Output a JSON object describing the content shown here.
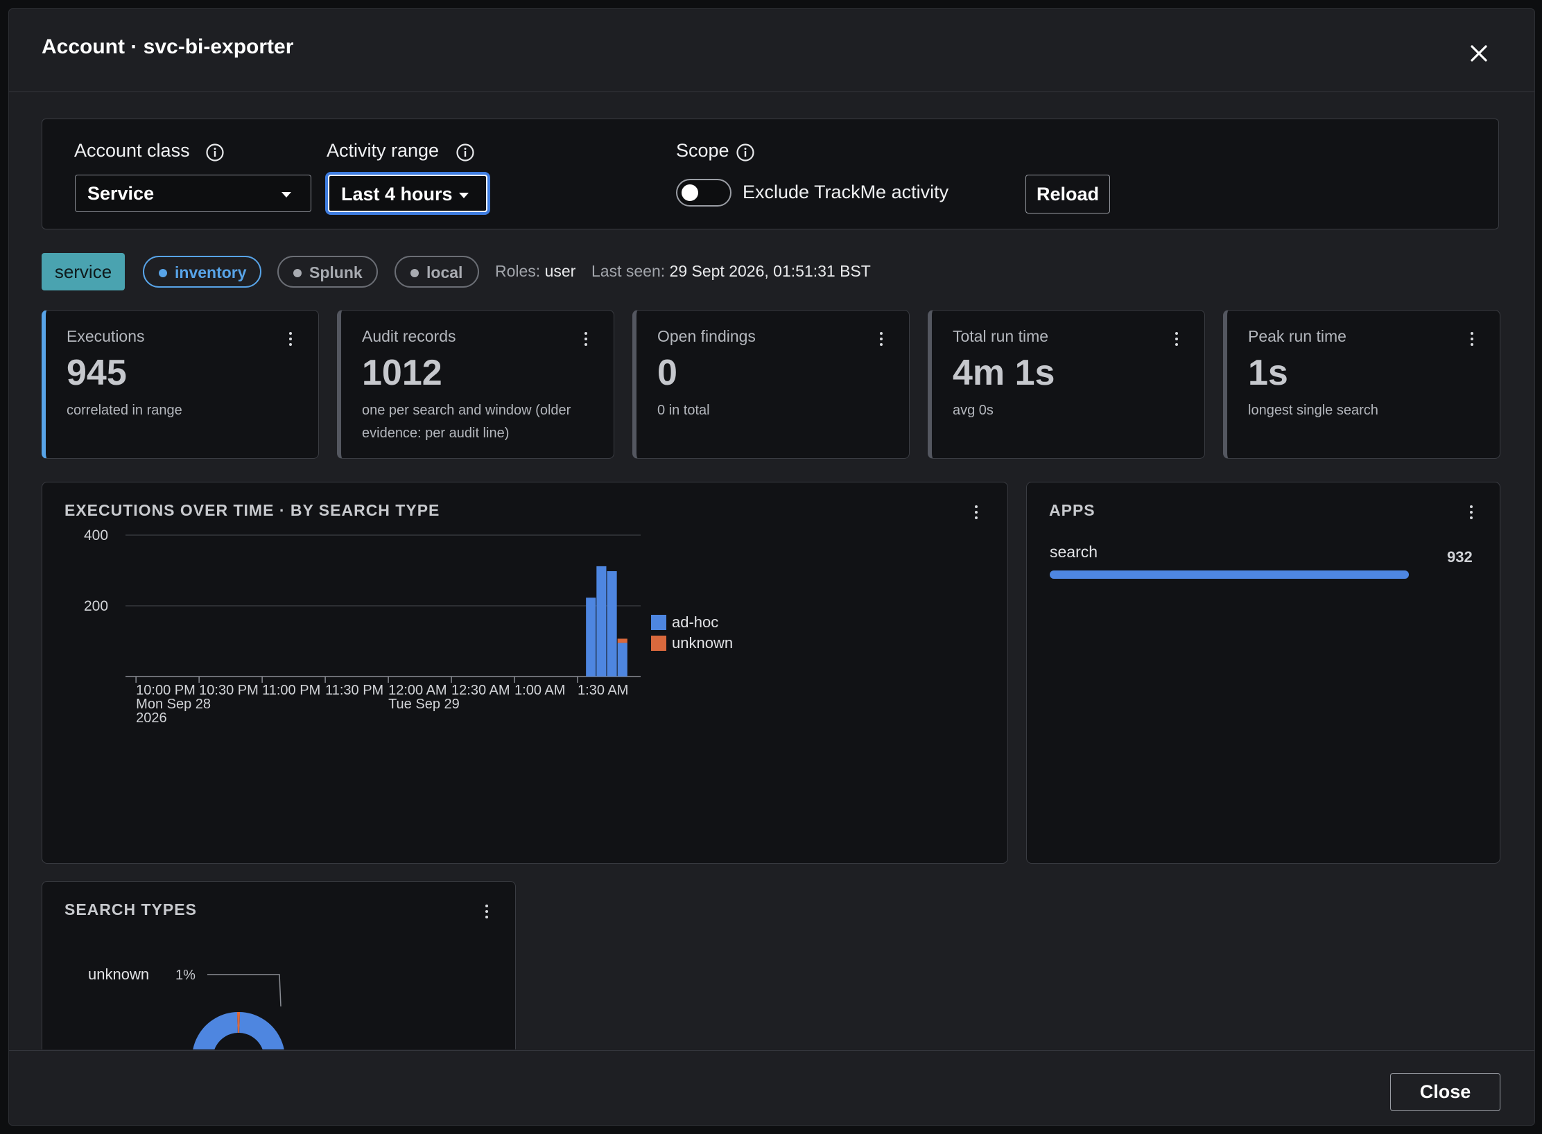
{
  "modal": {
    "title": "Account · svc-bi-exporter",
    "close_icon": "close-icon"
  },
  "filters": {
    "account_class": {
      "label": "Account class",
      "value": "Service"
    },
    "activity_range": {
      "label": "Activity range",
      "value": "Last 4 hours"
    },
    "scope": {
      "label": "Scope",
      "toggle_label": "Exclude TrackMe activity",
      "toggle_on": false
    },
    "reload_label": "Reload"
  },
  "tags": {
    "type": "service",
    "pills": [
      {
        "label": "inventory",
        "color": "#58a4e8"
      },
      {
        "label": "Splunk",
        "color": "#9a9da4"
      },
      {
        "label": "local",
        "color": "#9a9da4"
      }
    ],
    "roles_label": "Roles:",
    "roles_value": "user",
    "last_seen_label": "Last seen:",
    "last_seen_value": "29 Sept 2026, 01:51:31 BST"
  },
  "kpis": [
    {
      "label": "Executions",
      "value": "945",
      "sub": "correlated in range"
    },
    {
      "label": "Audit records",
      "value": "1012",
      "sub": "one per search and window (older evidence: per audit line)"
    },
    {
      "label": "Open findings",
      "value": "0",
      "sub": "0 in total"
    },
    {
      "label": "Total run time",
      "value": "4m 1s",
      "sub": "avg 0s"
    },
    {
      "label": "Peak run time",
      "value": "1s",
      "sub": "longest single search"
    }
  ],
  "executions_panel": {
    "title": "EXECUTIONS OVER TIME · BY SEARCH TYPE"
  },
  "apps_panel": {
    "title": "APPS",
    "items": [
      {
        "name": "search",
        "value": "932",
        "fraction": 1.0
      }
    ]
  },
  "search_types_panel": {
    "title": "SEARCH TYPES",
    "callout_label": "unknown",
    "callout_pct": "1%"
  },
  "footer": {
    "close_label": "Close"
  },
  "colors": {
    "adhoc": "#4e86e0",
    "unknown": "#d9693d",
    "accent": "#3f7de0"
  },
  "chart_data": [
    {
      "type": "bar",
      "stacked": true,
      "x_tick_labels": [
        [
          "10:00 PM",
          "Mon Sep 28",
          "2026"
        ],
        [
          "10:30 PM"
        ],
        [
          "11:00 PM"
        ],
        [
          "11:30 PM"
        ],
        [
          "12:00 AM",
          "Tue Sep 29"
        ],
        [
          "12:30 AM"
        ],
        [
          "1:00 AM"
        ],
        [
          "1:30 AM"
        ]
      ],
      "x_tick_minutes": [
        0,
        30,
        60,
        90,
        120,
        150,
        180,
        210
      ],
      "x_range_minutes": [
        -5,
        240
      ],
      "ylim": [
        0,
        400
      ],
      "y_ticks": [
        200,
        400
      ],
      "grid": true,
      "legend": "right",
      "bars_minutes": [
        214,
        219,
        224,
        229,
        234
      ],
      "series": [
        {
          "name": "ad-hoc",
          "values": [
            223,
            312,
            298,
            95,
            0
          ]
        },
        {
          "name": "unknown",
          "values": [
            0,
            0,
            0,
            12,
            0
          ]
        }
      ]
    },
    {
      "type": "pie",
      "donut": true,
      "labels": [
        "ad-hoc",
        "unknown"
      ],
      "values": [
        99,
        1
      ]
    }
  ]
}
